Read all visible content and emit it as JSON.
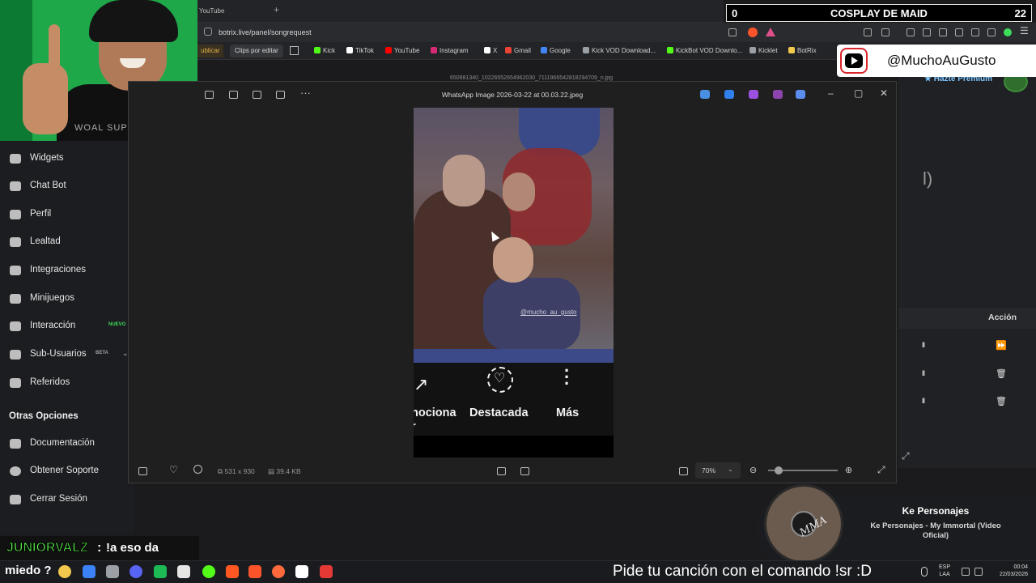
{
  "browser": {
    "tab_title": "YouTube",
    "new_tab_symbol": "+",
    "url": "botrix.live/panel/songrequest",
    "bookmarks": [
      {
        "label": "Kick",
        "color": "#53fc18"
      },
      {
        "label": "TikTok",
        "color": "#ffffff"
      },
      {
        "label": "YouTube",
        "color": "#ff0000"
      },
      {
        "label": "Instagram",
        "color": "#d62976"
      },
      {
        "label": "X",
        "color": "#ffffff"
      },
      {
        "label": "Gmail",
        "color": "#ea4335"
      },
      {
        "label": "Google",
        "color": "#4285f4"
      },
      {
        "label": "Kick VOD Download...",
        "color": "#9aa0a6"
      },
      {
        "label": "KickBot VOD Downlo...",
        "color": "#53fc18"
      },
      {
        "label": "Kicklet",
        "color": "#9aa0a6"
      },
      {
        "label": "BotRix",
        "color": "#f2c94c"
      }
    ],
    "publish_chip": "ublicar",
    "clips_chip": "Clips por editar"
  },
  "scoreboard": {
    "left": "0",
    "title": "COSPLAY DE MAID",
    "right": "22"
  },
  "youtube_handle": "@MuchoAuGusto",
  "webcam": {
    "shirt_text": "WOAL SUPREME"
  },
  "sidebar": {
    "items": [
      {
        "label": "Widgets",
        "icon": "widgets-icon"
      },
      {
        "label": "Chat Bot",
        "icon": "robot-icon"
      },
      {
        "label": "Perfil",
        "icon": "profile-card-icon"
      },
      {
        "label": "Lealtad",
        "icon": "trophy-icon"
      },
      {
        "label": "Integraciones",
        "icon": "plug-icon"
      },
      {
        "label": "Minijuegos",
        "icon": "gamepad-icon"
      },
      {
        "label": "Interacción",
        "icon": "music-note-icon",
        "badge": "NUEVO",
        "badge_color": "#3ddc5a"
      },
      {
        "label": "Sub-Usuarios",
        "icon": "users-icon",
        "badge": "BETA",
        "badge_color": "#9aa0a6"
      },
      {
        "label": "Referidos",
        "icon": "referral-icon"
      }
    ],
    "section_title": "Otras Opciones",
    "other_items": [
      {
        "label": "Documentación",
        "icon": "doc-icon"
      },
      {
        "label": "Obtener Soporte",
        "icon": "help-icon"
      },
      {
        "label": "Cerrar Sesión",
        "icon": "logout-icon"
      }
    ]
  },
  "right_panel": {
    "premium": "Hazte Premium",
    "partial_glyph": "l)",
    "column_action": "Acción",
    "rows": [
      {
        "bars": "lll",
        "action": "⏩"
      },
      {
        "bars": "lll",
        "action": "🗑"
      },
      {
        "bars": "lll",
        "action": "🗑"
      }
    ]
  },
  "viewer": {
    "background_title": "650981340_10226552654962030_7111966542818294709_n.jpg",
    "title": "WhatsApp Image 2026-03-22 at 00.03.22.jpeg",
    "app_icon_colors": [
      "#4a90e2",
      "#2f80ed",
      "#9b51e0",
      "#8e44ad",
      "#5b8def"
    ],
    "dimensions": "531 x 930",
    "file_size": "39.4 KB",
    "zoom": "70%",
    "image": {
      "watermark": "@mucho_au_gusto",
      "actions": [
        {
          "label": "nociona\nr",
          "icon": "trending-icon"
        },
        {
          "label": "Destacada",
          "icon": "heart-circle-icon"
        },
        {
          "label": "Más",
          "icon": "more-vertical-icon"
        }
      ]
    }
  },
  "now_playing": {
    "artist": "Ke Personajes",
    "track": "Ke Personajes - My Immortal (Video Oficial)",
    "disc_text": "MMA"
  },
  "chat": {
    "user": "JUNIORVALZ",
    "separator": ":",
    "message": "!a eso da"
  },
  "taskbar": {
    "left_text": "miedo ?",
    "ticker": "Pide tu canción con el comando !sr :D",
    "lang": "ESP",
    "lang_sub": "LAA",
    "time": "00:04",
    "date": "22/03/2026",
    "app_colors": [
      "#f2c94c",
      "#3b82f6",
      "#9aa0a6",
      "#5865f2",
      "#1db954",
      "#e5e5e5",
      "#53fc18",
      "#ff5722",
      "#fb542b",
      "#ff6a3d",
      "#ffffff",
      "#e53935",
      "#4aa3df"
    ]
  }
}
